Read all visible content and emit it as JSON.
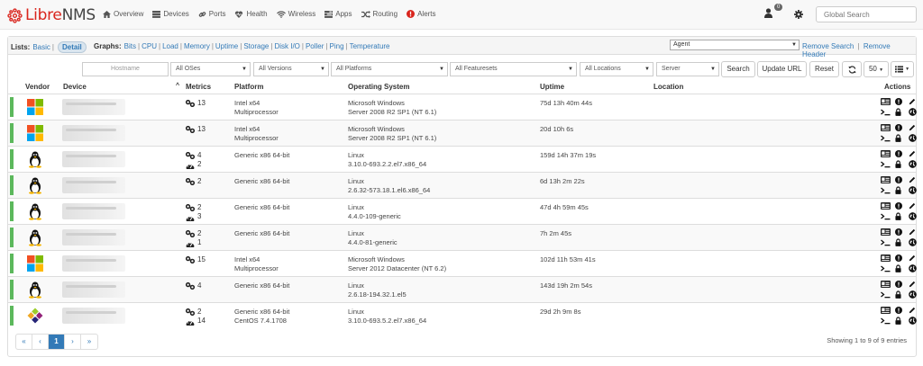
{
  "brand": {
    "name_left": "Libre",
    "name_right": "NMS"
  },
  "nav": {
    "items": [
      {
        "label": "Overview",
        "icon": "home-icon"
      },
      {
        "label": "Devices",
        "icon": "server-icon"
      },
      {
        "label": "Ports",
        "icon": "link-icon"
      },
      {
        "label": "Health",
        "icon": "heartbeat-icon"
      },
      {
        "label": "Wireless",
        "icon": "wifi-icon"
      },
      {
        "label": "Apps",
        "icon": "tasks-icon"
      },
      {
        "label": "Routing",
        "icon": "random-icon"
      },
      {
        "label": "Alerts",
        "icon": "exclamation-circle-icon"
      }
    ],
    "notification_count": "0",
    "search_placeholder": "Global Search"
  },
  "toolbar": {
    "lists_label": "Lists:",
    "list_basic": "Basic",
    "list_detail": "Detail",
    "graphs_label": "Graphs:",
    "graphs": [
      "Bits",
      "CPU",
      "Load",
      "Memory",
      "Uptime",
      "Storage",
      "Disk I/O",
      "Poller",
      "Ping",
      "Temperature"
    ],
    "agent_value": "Agent",
    "remove_search": "Remove Search",
    "remove_header": "Remove Header"
  },
  "filters": {
    "hostname_placeholder": "Hostname",
    "os": "All OSes",
    "versions": "All Versions",
    "platforms": "All Platforms",
    "featuresets": "All Featuresets",
    "locations": "All Locations",
    "type": "Server",
    "search_btn": "Search",
    "update_url_btn": "Update URL",
    "reset_btn": "Reset",
    "page_size": "50"
  },
  "columns": {
    "vendor": "Vendor",
    "device": "Device",
    "metrics": "Metrics",
    "platform": "Platform",
    "os": "Operating System",
    "uptime": "Uptime",
    "location": "Location",
    "actions": "Actions"
  },
  "rows": [
    {
      "vendor": "windows",
      "ports": "13",
      "sensors": "",
      "platform1": "Intel x64",
      "platform2": "Multiprocessor",
      "os1": "Microsoft Windows",
      "os2": "Server 2008 R2 SP1 (NT 6.1)",
      "uptime": "75d 13h 40m 44s"
    },
    {
      "vendor": "windows",
      "ports": "13",
      "sensors": "",
      "platform1": "Intel x64",
      "platform2": "Multiprocessor",
      "os1": "Microsoft Windows",
      "os2": "Server 2008 R2 SP1 (NT 6.1)",
      "uptime": "20d 10h 6s"
    },
    {
      "vendor": "linux",
      "ports": "4",
      "sensors": "2",
      "platform1": "Generic x86 64-bit",
      "platform2": "",
      "os1": "Linux",
      "os2": "3.10.0-693.2.2.el7.x86_64",
      "uptime": "159d 14h 37m 19s"
    },
    {
      "vendor": "linux",
      "ports": "2",
      "sensors": "",
      "platform1": "Generic x86 64-bit",
      "platform2": "",
      "os1": "Linux",
      "os2": "2.6.32-573.18.1.el6.x86_64",
      "uptime": "6d 13h 2m 22s"
    },
    {
      "vendor": "linux",
      "ports": "2",
      "sensors": "3",
      "platform1": "Generic x86 64-bit",
      "platform2": "",
      "os1": "Linux",
      "os2": "4.4.0-109-generic",
      "uptime": "47d 4h 59m 45s"
    },
    {
      "vendor": "linux",
      "ports": "2",
      "sensors": "1",
      "platform1": "Generic x86 64-bit",
      "platform2": "",
      "os1": "Linux",
      "os2": "4.4.0-81-generic",
      "uptime": "7h 2m 45s"
    },
    {
      "vendor": "windows",
      "ports": "15",
      "sensors": "",
      "platform1": "Intel x64",
      "platform2": "Multiprocessor",
      "os1": "Microsoft Windows",
      "os2": "Server 2012 Datacenter (NT 6.2)",
      "uptime": "102d 11h 53m 41s"
    },
    {
      "vendor": "linux",
      "ports": "4",
      "sensors": "",
      "platform1": "Generic x86 64-bit",
      "platform2": "",
      "os1": "Linux",
      "os2": "2.6.18-194.32.1.el5",
      "uptime": "143d 19h 2m 54s"
    },
    {
      "vendor": "centos",
      "ports": "2",
      "sensors": "14",
      "platform1": "Generic x86 64-bit",
      "platform2": "CentOS 7.4.1708",
      "os1": "Linux",
      "os2": "3.10.0-693.5.2.el7.x86_64",
      "uptime": "29d 2h 9m 8s"
    }
  ],
  "pagination": {
    "first": "«",
    "prev": "‹",
    "current": "1",
    "next": "›",
    "last": "»"
  },
  "footer": {
    "showing": "Showing 1 to 9 of 9 entries"
  },
  "colors": {
    "status_up": "#5cb85c",
    "link": "#337ab7",
    "brand_red": "#d9251d"
  }
}
